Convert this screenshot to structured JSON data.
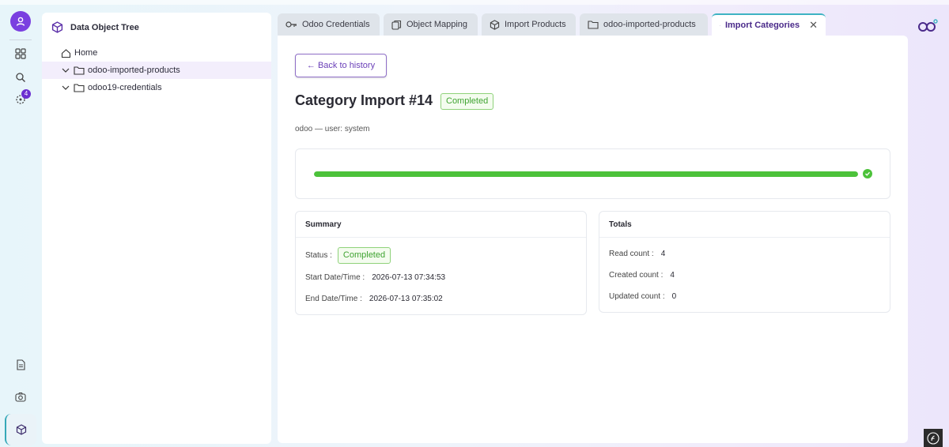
{
  "tree": {
    "title": "Data Object Tree",
    "items": [
      {
        "label": "Home"
      },
      {
        "label": "odoo-imported-products"
      },
      {
        "label": "odoo19-credentials"
      }
    ]
  },
  "rail": {
    "badge_count": "4"
  },
  "tabs": [
    {
      "label": "Odoo Credentials",
      "icon": "key-icon"
    },
    {
      "label": "Object Mapping",
      "icon": "mapping-icon"
    },
    {
      "label": "Import Products",
      "icon": "cube-icon"
    },
    {
      "label": "odoo-imported-products",
      "icon": "folder-icon"
    },
    {
      "label": "Import Categories",
      "icon": "hierarchy-icon"
    }
  ],
  "main": {
    "back_label": "← Back to history",
    "title": "Category Import #14",
    "status": "Completed",
    "subtitle": "odoo — user: system",
    "progress": 1.0
  },
  "summary": {
    "heading": "Summary",
    "status_label": "Status :",
    "status_value": "Completed",
    "start_label": "Start Date/Time :",
    "start_value": "2026-07-13 07:34:53",
    "end_label": "End Date/Time :",
    "end_value": "2026-07-13 07:35:02"
  },
  "totals": {
    "heading": "Totals",
    "read_label": "Read count :",
    "read_value": "4",
    "created_label": "Created count :",
    "created_value": "4",
    "updated_label": "Updated count :",
    "updated_value": "0"
  },
  "colors": {
    "accent": "#7a3fe0",
    "success": "#4cc23a",
    "tab_active_border": "#3eb3c3"
  }
}
